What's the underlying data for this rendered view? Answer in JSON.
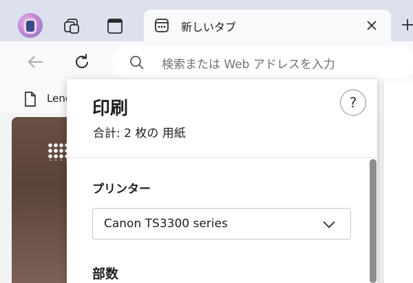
{
  "browser": {
    "tab": {
      "title": "新しいタブ"
    },
    "address_bar": {
      "placeholder": "検索または Web アドレスを入力"
    },
    "favorites": [
      {
        "label": "Leno"
      }
    ]
  },
  "print_dialog": {
    "title": "印刷",
    "summary": "合計: 2 枚の 用紙",
    "help_label": "?",
    "printer_label": "プリンター",
    "printer_value": "Canon TS3300 series",
    "copies_label": "部数"
  },
  "colors": {
    "tabstrip": "#dde1ee",
    "toolbar": "#f8f9fb",
    "dialog_bg": "#ffffff",
    "scroll_thumb": "#8d8d8d"
  },
  "icons": [
    "profile-avatar",
    "workspaces-icon",
    "vertical-tabs-icon",
    "new-tab-page-icon",
    "close-icon",
    "plus-icon",
    "back-arrow-icon",
    "refresh-icon",
    "search-icon",
    "document-icon",
    "chevron-down-icon",
    "help-icon"
  ]
}
